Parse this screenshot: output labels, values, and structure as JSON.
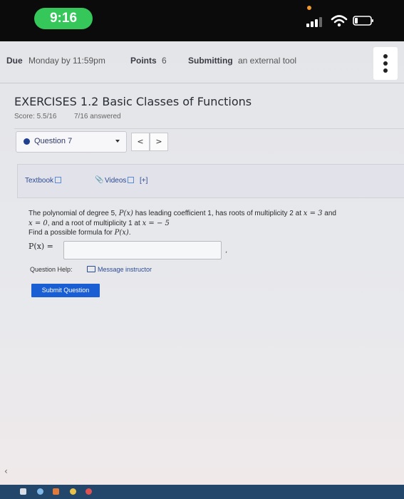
{
  "status_bar": {
    "time": "9:16"
  },
  "assignment_header": {
    "due_label": "Due",
    "due_value": "Monday by 11:59pm",
    "points_label": "Points",
    "points_value": "6",
    "submitting_label": "Submitting",
    "submitting_value": "an external tool"
  },
  "exercise": {
    "title": "EXERCISES 1.2 Basic Classes of Functions",
    "score": "Score: 5.5/16",
    "answered": "7/16 answered"
  },
  "question_nav": {
    "selected_question": "Question 7",
    "prev": "<",
    "next": ">"
  },
  "resources": {
    "textbook": "Textbook",
    "videos": "Videos",
    "expand": "[+]"
  },
  "question": {
    "line1_a": "The polynomial of degree 5,",
    "line1_b": "P(x)",
    "line1_c": "has leading coefficient 1, has roots of multiplicity 2 at",
    "line1_d": "x = 3",
    "line1_e": "and",
    "line2_a": "x = 0",
    "line2_b": ", and a root of multiplicity 1 at",
    "line2_c": "x = − 5",
    "line3_a": "Find a possible formula for",
    "line3_b": "P(x)",
    "line3_c": ".",
    "answer_label": "P(x) =",
    "answer_value": "",
    "comma": ","
  },
  "help": {
    "label": "Question Help:",
    "message_link": "Message instructor"
  },
  "submit_label": "Submit Question",
  "colors": {
    "status_time_pill": "#35c759",
    "link_blue": "#2c4a93",
    "submit_blue": "#1a5ed4"
  }
}
